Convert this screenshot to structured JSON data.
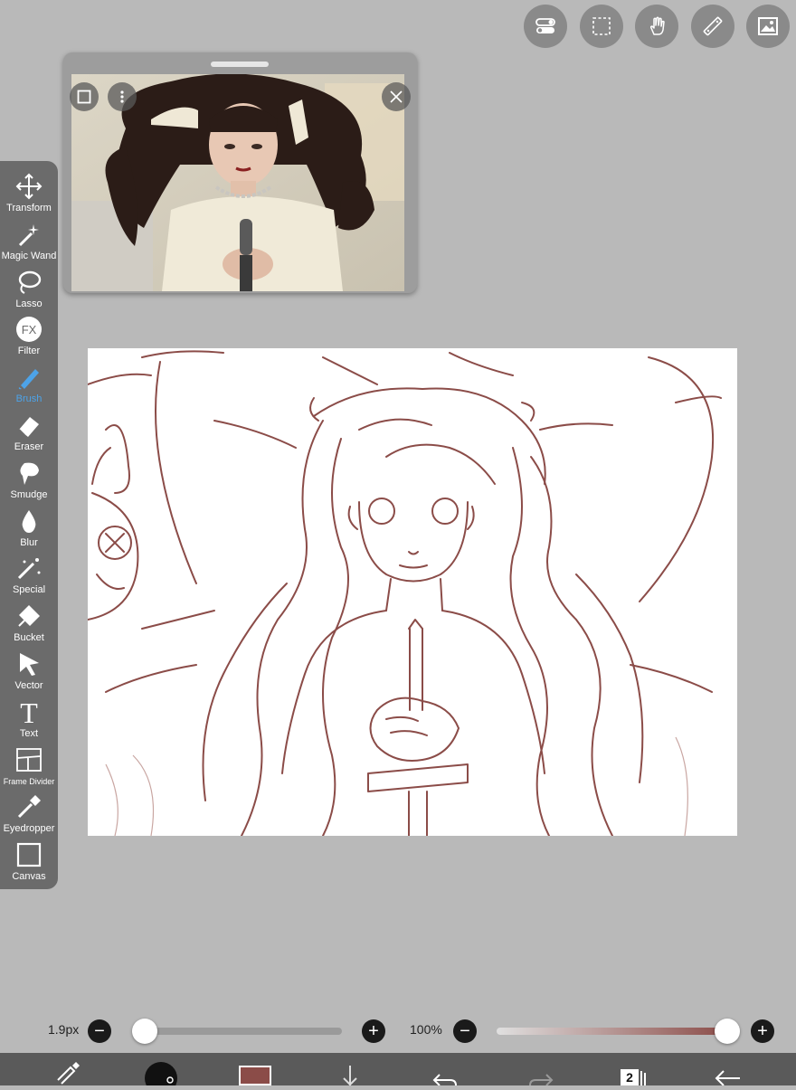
{
  "top_toolbar": {
    "icons": [
      "toggle-icon",
      "selection-icon",
      "hand-tool-icon",
      "ruler-icon",
      "image-icon"
    ]
  },
  "reference": {
    "icons": [
      "handle-icon",
      "square-icon",
      "more-icon",
      "close-icon"
    ]
  },
  "tools": [
    {
      "label": "Transform",
      "icon": "move-arrows-icon"
    },
    {
      "label": "Magic Wand",
      "icon": "magic-wand-icon"
    },
    {
      "label": "Lasso",
      "icon": "lasso-icon"
    },
    {
      "label": "Filter",
      "icon": "fx-icon"
    },
    {
      "label": "Brush",
      "icon": "brush-icon",
      "active": true
    },
    {
      "label": "Eraser",
      "icon": "eraser-icon"
    },
    {
      "label": "Smudge",
      "icon": "smudge-icon"
    },
    {
      "label": "Blur",
      "icon": "drop-icon"
    },
    {
      "label": "Special",
      "icon": "special-icon"
    },
    {
      "label": "Bucket",
      "icon": "bucket-icon"
    },
    {
      "label": "Vector",
      "icon": "cursor-arrow-icon"
    },
    {
      "label": "Text",
      "icon": "text-icon"
    },
    {
      "label": "Frame Divider",
      "icon": "frame-divider-icon"
    },
    {
      "label": "Eyedropper",
      "icon": "eyedropper-icon"
    },
    {
      "label": "Canvas",
      "icon": "canvas-icon"
    }
  ],
  "brush_size": {
    "label": "1.9px",
    "value_fraction": 0.0
  },
  "opacity": {
    "label": "100%",
    "value_fraction": 1.0
  },
  "bottom_bar": {
    "layer_count": "2",
    "brush_color": "#8b4c48",
    "icons": [
      "brush-settings-icon",
      "brush-preview-icon",
      "color-swatch-icon",
      "download-icon",
      "undo-icon",
      "redo-icon",
      "layers-icon",
      "back-icon"
    ]
  },
  "colors": {
    "accent": "#4da3e8",
    "line_art": "#8b4c48",
    "panel": "#6b6b6b",
    "background": "#b9b9b9"
  }
}
